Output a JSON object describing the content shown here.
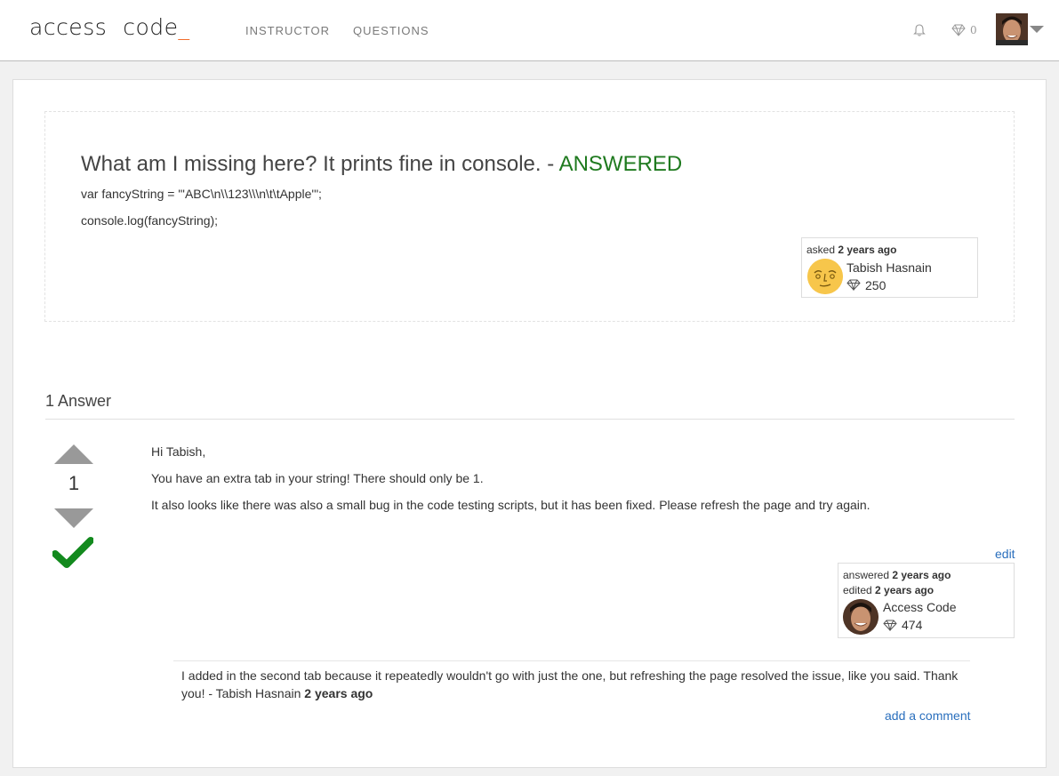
{
  "nav": {
    "brand_word1": "access",
    "brand_word2": "code",
    "brand_cursor": "_",
    "links": [
      "INSTRUCTOR",
      "QUESTIONS"
    ],
    "points": "0"
  },
  "question": {
    "title": "What am I missing here? It prints fine in console.",
    "separator": " - ",
    "status": "ANSWERED",
    "code_line1": "var fancyString = \"'ABC\\n\\\\123\\\\\\n\\t\\tApple'\";",
    "code_line2": "console.log(fancyString);",
    "asked_label": "asked",
    "asked_time": "2 years ago",
    "author_name": "Tabish Hasnain",
    "author_rep": "250"
  },
  "answers": {
    "heading": "1 Answer",
    "items": [
      {
        "votes": "1",
        "body": [
          "Hi Tabish,",
          "You have an extra tab in your string! There should only be 1.",
          "It also looks like there was also a small bug in the code testing scripts, but it has been fixed. Please refresh the page and try again."
        ],
        "edit_label": "edit",
        "answered_label": "answered",
        "answered_time": "2 years ago",
        "edited_label": "edited",
        "edited_time": "2 years ago",
        "author_name": "Access Code",
        "author_rep": "474",
        "comment": {
          "text": "I added in the second tab because it repeatedly wouldn't go with just the one, but refreshing the page resolved the issue, like you said. Thank you!",
          "dash": " - ",
          "author": "Tabish Hasnain",
          "time": "2 years ago"
        },
        "add_comment_label": "add a comment"
      }
    ]
  },
  "colors": {
    "answered_green": "#1f7a1f",
    "brand_cursor": "#f26522",
    "link_blue": "#2a6fbd",
    "vote_arrow_gray": "#999999",
    "check_green": "#138a1e"
  }
}
